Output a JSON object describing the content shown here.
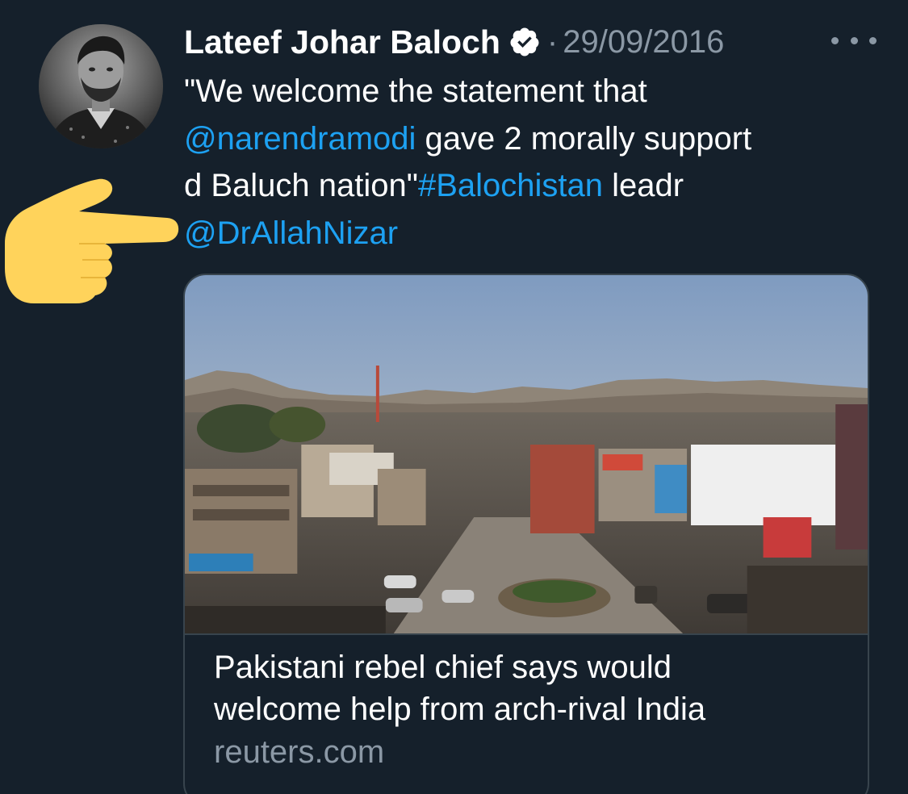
{
  "tweet": {
    "author": {
      "name": "Lateef Johar Baloch",
      "verified_icon": "verified-badge-icon"
    },
    "separator": "·",
    "date": "29/09/2016",
    "more_icon": "more-options-icon",
    "text": {
      "line1": "\"We welcome the statement that",
      "mention1": "@narendramodi",
      "line2_rest": " gave 2 morally support",
      "line3_start": "d Baluch nation\"",
      "hashtag": "#Balochistan",
      "line3_end": " leadr",
      "mention2": "@DrAllahNizar"
    },
    "card": {
      "title_line1": "Pakistani rebel chief says would",
      "title_line2": "welcome help from arch-rival India",
      "domain": "reuters.com"
    }
  },
  "colors": {
    "background": "#15202b",
    "text": "#ffffff",
    "secondary": "#8b98a5",
    "link": "#1da1f2",
    "border": "#38444d",
    "hand": "#ffd35b"
  }
}
